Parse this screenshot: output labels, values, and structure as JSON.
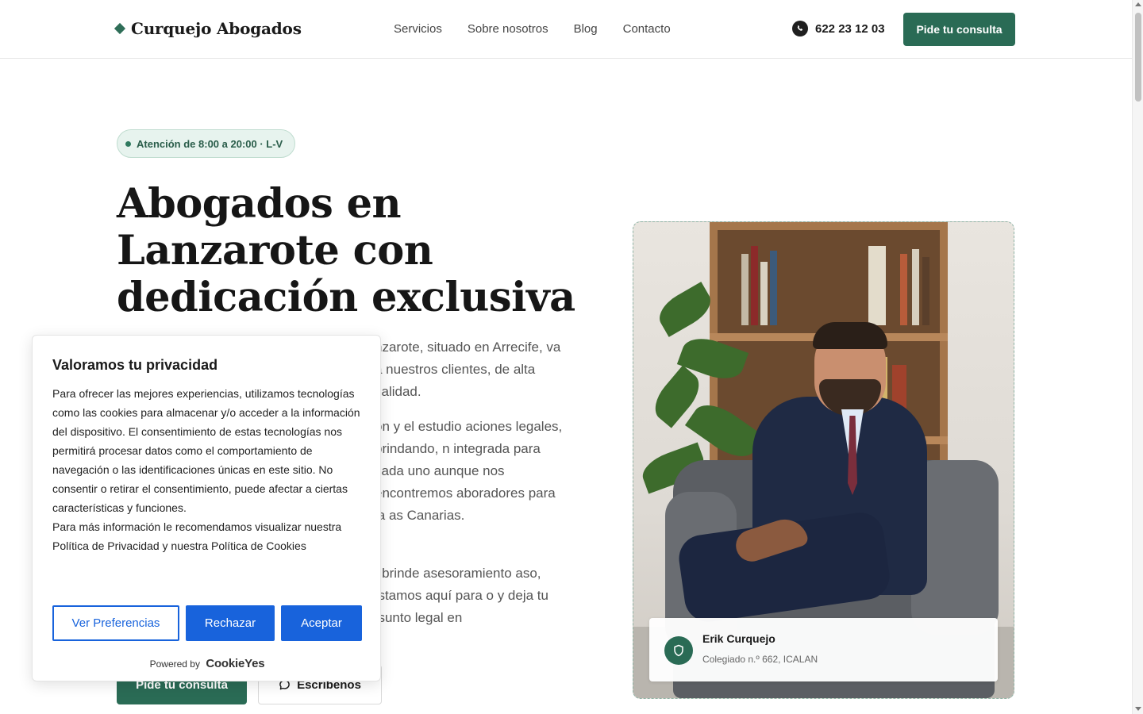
{
  "header": {
    "logo": "Curquejo Abogados",
    "nav": [
      "Servicios",
      "Sobre nosotros",
      "Blog",
      "Contacto"
    ],
    "phone": "622 23 12 03",
    "cta": "Pide tu consulta"
  },
  "hero": {
    "badge": "Atención de 8:00 a 20:00 · L-V",
    "title": "Abogados en Lanzarote con dedicación exclusiva",
    "paragraph1": "nzarote, situado en Arrecife, va a nuestros clientes, de alta calidad.",
    "paragraph2": "on y el estudio aciones legales, brindando, n integrada para cada uno aunque nos encontremos aboradores para la as Canarias.",
    "paragraph3": "e brinde asesoramiento aso, estamos aquí para o y deja tu asunto legal en",
    "primary_button": "Pide tu consulta",
    "secondary_button": "Escríbenos"
  },
  "profile": {
    "name": "Erik Curquejo",
    "credential": "Colegiado n.º 662, ICALAN"
  },
  "cookie": {
    "title": "Valoramos tu privacidad",
    "text1": "Para ofrecer las mejores experiencias, utilizamos tecnologías como las cookies para almacenar y/o acceder a la información del dispositivo. El consentimiento de estas tecnologías nos permitirá procesar datos como el comportamiento de navegación o las identificaciones únicas en este sitio. No consentir o retirar el consentimiento, puede afectar a ciertas características y funciones.",
    "text2": "Para más información le recomendamos visualizar nuestra Política de Privacidad y nuestra Política de Cookies",
    "btn_preferences": "Ver Preferencias",
    "btn_reject": "Rechazar",
    "btn_accept": "Aceptar",
    "powered_by": "Powered by",
    "brand": "CookieYes"
  },
  "colors": {
    "brand_green": "#2a6b55",
    "cookie_blue": "#1863dc"
  },
  "icons": {
    "phone": "whatsapp-icon",
    "shield": "shield-icon",
    "chat": "chat-bubble-icon"
  }
}
